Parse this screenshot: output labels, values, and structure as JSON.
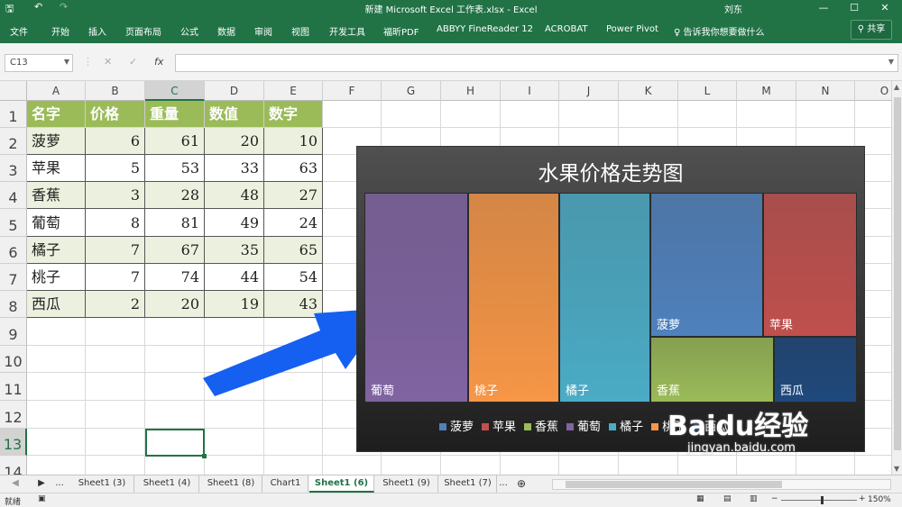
{
  "titlebar": {
    "title": "新建 Microsoft Excel 工作表.xlsx  -  Excel",
    "user": "刘东",
    "minimize": "—",
    "restore": "☐",
    "close": "✕",
    "quick_undo": "↶",
    "quick_redo": "↷",
    "quick_save": "🖫"
  },
  "ribbon": {
    "tabs": [
      "文件",
      "开始",
      "插入",
      "页面布局",
      "公式",
      "数据",
      "审阅",
      "视图",
      "开发工具",
      "福昕PDF",
      "ABBYY FineReader 12",
      "ACROBAT",
      "Power Pivot"
    ],
    "tell_me": "告诉我你想要做什么",
    "share": "共享"
  },
  "formula_bar": {
    "name_box": "C13",
    "cancel": "✕",
    "enter": "✓",
    "fx": "fx",
    "value": ""
  },
  "grid": {
    "columns": [
      "A",
      "B",
      "C",
      "D",
      "E",
      "F",
      "G",
      "H",
      "I",
      "J",
      "K",
      "L",
      "M",
      "N",
      "O"
    ],
    "rows": [
      "1",
      "2",
      "3",
      "4",
      "5",
      "6",
      "7",
      "8",
      "9",
      "10",
      "11",
      "12",
      "13",
      "14"
    ],
    "headers": [
      "名字",
      "价格",
      "重量",
      "数值",
      "数字"
    ],
    "data": [
      [
        "菠萝",
        "6",
        "61",
        "20",
        "10"
      ],
      [
        "苹果",
        "5",
        "53",
        "33",
        "63"
      ],
      [
        "香蕉",
        "3",
        "28",
        "48",
        "27"
      ],
      [
        "葡萄",
        "8",
        "81",
        "49",
        "24"
      ],
      [
        "橘子",
        "7",
        "67",
        "35",
        "65"
      ],
      [
        "桃子",
        "7",
        "74",
        "44",
        "54"
      ],
      [
        "西瓜",
        "2",
        "20",
        "19",
        "43"
      ]
    ],
    "selected_column": "C",
    "selected_row": "13"
  },
  "chart_data": {
    "type": "treemap",
    "title": "水果价格走势图",
    "categories": [
      "葡萄",
      "桃子",
      "橘子",
      "菠萝",
      "苹果",
      "香蕉",
      "西瓜"
    ],
    "values": [
      8,
      7,
      7,
      6,
      5,
      3,
      2
    ],
    "colors": {
      "葡萄": "#8064a2",
      "桃子": "#f79646",
      "橘子": "#4bacc6",
      "菠萝": "#4f81bd",
      "苹果": "#c0504d",
      "香蕉": "#9bbb59",
      "西瓜": "#1f497d"
    },
    "legend": [
      "菠萝",
      "苹果",
      "香蕉",
      "葡萄",
      "橘子",
      "桃子",
      "西瓜"
    ],
    "legend_position": "bottom"
  },
  "sheet_tabs": {
    "nav_prev": "◀",
    "nav_next": "▶",
    "more": "...",
    "tabs": [
      "Sheet1 (3)",
      "Sheet1 (4)",
      "Sheet1 (8)",
      "Chart1",
      "Sheet1 (6)",
      "Sheet1 (9)",
      "Sheet1 (7)"
    ],
    "active": "Sheet1 (6)",
    "more_right": "...",
    "add": "⊕"
  },
  "status_bar": {
    "mode": "就绪",
    "zoom": "150%",
    "zoom_out": "−",
    "zoom_in": "+"
  },
  "watermark": {
    "text": "Baidu经验",
    "url": "jingyan.baidu.com"
  }
}
